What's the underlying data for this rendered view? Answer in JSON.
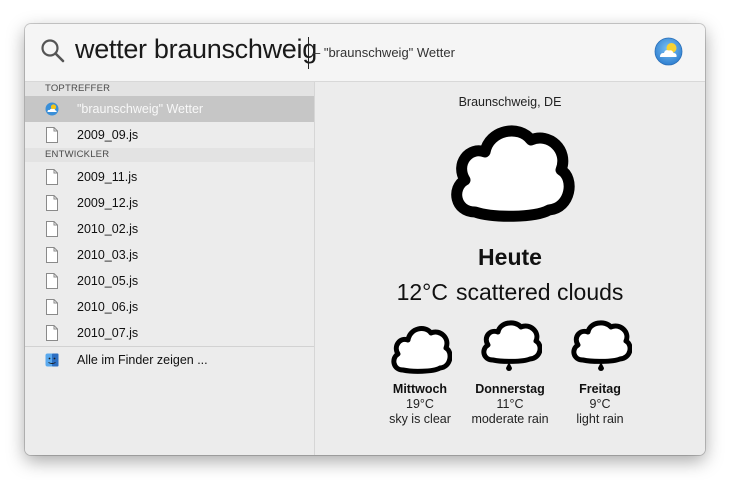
{
  "search": {
    "query": "wetter braunschweig",
    "suggestion": "– \"braunschweig\" Wetter"
  },
  "results": {
    "sections": [
      {
        "header": "TOPTREFFER",
        "items": [
          {
            "label": "\"braunschweig\" Wetter",
            "icon": "weather-app-icon",
            "selected": true
          },
          {
            "label": "2009_09.js",
            "icon": "document-icon",
            "selected": false
          }
        ]
      },
      {
        "header": "ENTWICKLER",
        "items": [
          {
            "label": "2009_11.js",
            "icon": "document-icon"
          },
          {
            "label": "2009_12.js",
            "icon": "document-icon"
          },
          {
            "label": "2010_02.js",
            "icon": "document-icon"
          },
          {
            "label": "2010_03.js",
            "icon": "document-icon"
          },
          {
            "label": "2010_05.js",
            "icon": "document-icon"
          },
          {
            "label": "2010_06.js",
            "icon": "document-icon"
          },
          {
            "label": "2010_07.js",
            "icon": "document-icon"
          }
        ]
      }
    ],
    "finder_action": {
      "label": "Alle im Finder zeigen ...",
      "icon": "finder-icon"
    }
  },
  "weather": {
    "location": "Braunschweig, DE",
    "today": {
      "label": "Heute",
      "temperature": "12°C",
      "condition": "scattered clouds",
      "icon": "cloud-icon"
    },
    "forecast": [
      {
        "day": "Mittwoch",
        "temperature": "19°C",
        "condition": "sky is clear",
        "icon": "cloud-icon"
      },
      {
        "day": "Donnerstag",
        "temperature": "11°C",
        "condition": "moderate rain",
        "icon": "rain-cloud-icon"
      },
      {
        "day": "Freitag",
        "temperature": "9°C",
        "condition": "light rain",
        "icon": "rain-cloud-icon"
      }
    ]
  },
  "colors": {
    "selection": "#c6c6c6",
    "panel": "#ececec",
    "weather_icon_blue": "#3a8fd8",
    "weather_icon_sun": "#f5c518"
  }
}
